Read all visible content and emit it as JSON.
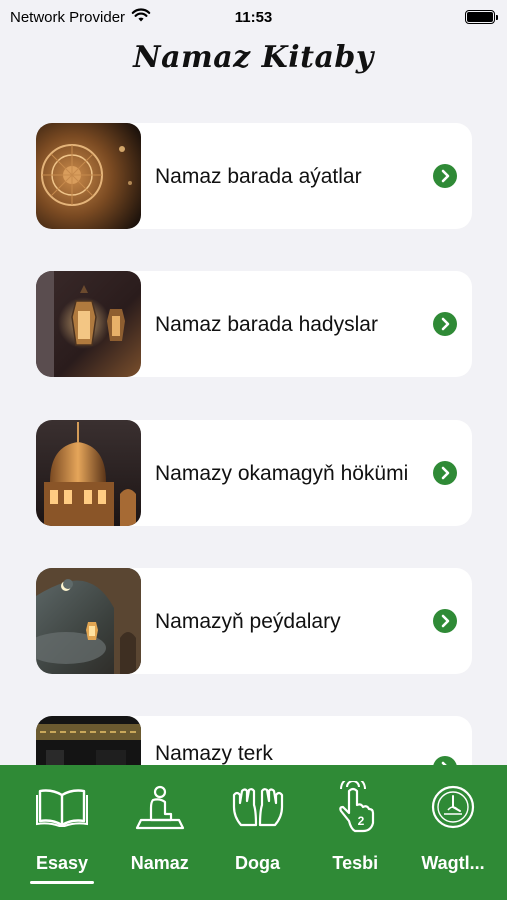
{
  "status_bar": {
    "carrier": "Network Provider",
    "time": "11:53",
    "wifi_icon": "wifi-icon",
    "battery_icon": "battery-icon"
  },
  "header": {
    "title": "Namaz Kitaby"
  },
  "cards": [
    {
      "label": "Namaz barada aýatlar",
      "image": "islamic-ornament-image",
      "icon": "chevron-right-icon"
    },
    {
      "label": "Namaz barada hadyslar",
      "image": "lanterns-image",
      "icon": "chevron-right-icon"
    },
    {
      "label": "Namazy okamagyň hökümi",
      "image": "mosque-dome-image",
      "icon": "chevron-right-icon"
    },
    {
      "label": "Namazyň peýdalary",
      "image": "moon-arch-image",
      "icon": "chevron-right-icon"
    },
    {
      "label": "Namazy terk",
      "image": "kaaba-image",
      "icon": "chevron-right-icon"
    }
  ],
  "tabbar": {
    "tabs": [
      {
        "label": "Esasy",
        "icon": "open-book-icon",
        "selected": true
      },
      {
        "label": "Namaz",
        "icon": "praying-person-icon",
        "selected": false
      },
      {
        "label": "Doga",
        "icon": "praying-hands-icon",
        "selected": false
      },
      {
        "label": "Tesbi",
        "icon": "tap-counter-icon",
        "badge": "2",
        "selected": false
      },
      {
        "label": "Wagtl...",
        "icon": "prayer-clock-icon",
        "selected": false
      }
    ]
  },
  "colors": {
    "accent": "#2f8a36",
    "background": "#f2f2f6",
    "card": "#ffffff"
  }
}
